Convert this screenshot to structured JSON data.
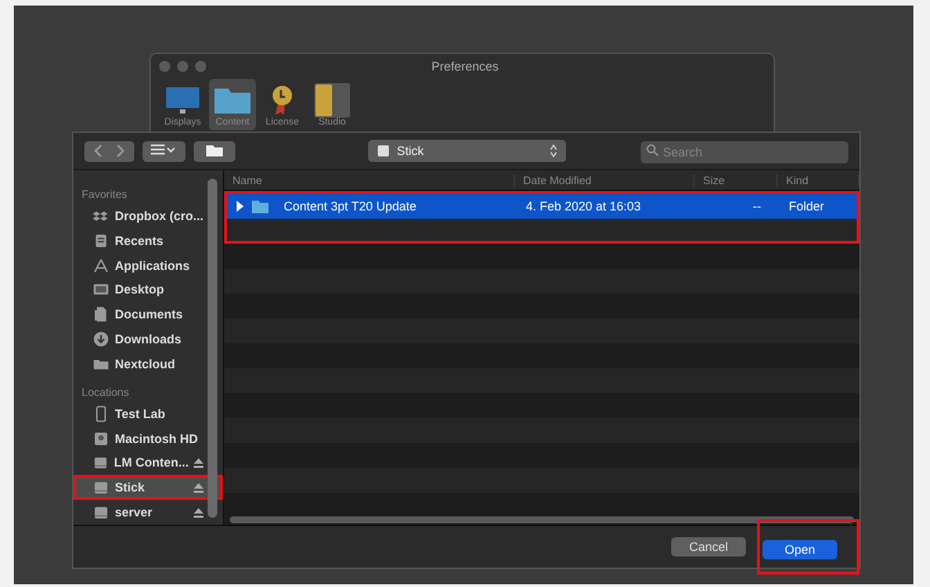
{
  "preferences_window": {
    "title": "Preferences",
    "toolbar": [
      {
        "label": "Displays",
        "kind": "display",
        "selected": false
      },
      {
        "label": "Content",
        "kind": "folder",
        "selected": true
      },
      {
        "label": "License",
        "kind": "medal",
        "selected": false
      },
      {
        "label": "Studio",
        "kind": "studio",
        "selected": false
      }
    ]
  },
  "dialog": {
    "location": "Stick",
    "search": {
      "placeholder": "Search"
    },
    "sidebar": [
      {
        "heading": "Favorites",
        "items": [
          {
            "label": "Dropbox (cro...",
            "kind": "dropbox",
            "selected": false,
            "ejectable": false,
            "highlighted": false
          },
          {
            "label": "Recents",
            "kind": "recents",
            "selected": false,
            "ejectable": false,
            "highlighted": false
          },
          {
            "label": "Applications",
            "kind": "applications",
            "selected": false,
            "ejectable": false,
            "highlighted": false
          },
          {
            "label": "Desktop",
            "kind": "desktop",
            "selected": false,
            "ejectable": false,
            "highlighted": false
          },
          {
            "label": "Documents",
            "kind": "documents",
            "selected": false,
            "ejectable": false,
            "highlighted": false
          },
          {
            "label": "Downloads",
            "kind": "downloads",
            "selected": false,
            "ejectable": false,
            "highlighted": false
          },
          {
            "label": "Nextcloud",
            "kind": "folder",
            "selected": false,
            "ejectable": false,
            "highlighted": false
          }
        ]
      },
      {
        "heading": "Locations",
        "items": [
          {
            "label": "Test Lab",
            "kind": "phone",
            "selected": false,
            "ejectable": false,
            "highlighted": false
          },
          {
            "label": "Macintosh HD",
            "kind": "disk",
            "selected": false,
            "ejectable": false,
            "highlighted": false
          },
          {
            "label": "LM Conten...",
            "kind": "drive",
            "selected": false,
            "ejectable": true,
            "highlighted": false
          },
          {
            "label": "Stick",
            "kind": "drive",
            "selected": true,
            "ejectable": true,
            "highlighted": true
          },
          {
            "label": "server",
            "kind": "drive",
            "selected": false,
            "ejectable": true,
            "highlighted": false
          }
        ]
      }
    ],
    "table": {
      "columns": [
        "Name",
        "Date Modified",
        "Size",
        "Kind"
      ],
      "rows": [
        {
          "name": "Content 3pt T20 Update",
          "date_modified": "4. Feb 2020 at 16:03",
          "size": "--",
          "kind": "Folder",
          "selected": true,
          "expanded": false,
          "highlighted": true
        }
      ]
    },
    "buttons": [
      {
        "label": "Cancel",
        "kind": "default",
        "highlighted": false
      },
      {
        "label": "Open",
        "kind": "primary",
        "highlighted": true
      }
    ]
  }
}
